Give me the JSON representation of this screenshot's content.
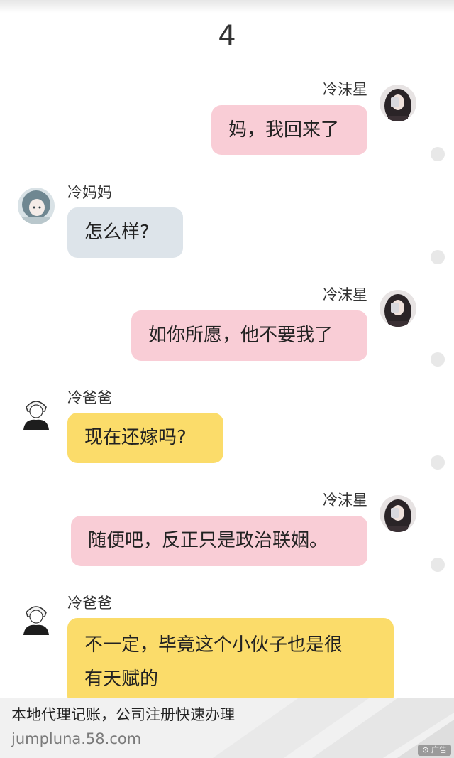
{
  "page": {
    "number": "4"
  },
  "messages": [
    {
      "side": "right",
      "sender": "冷沫星",
      "text": "妈，我回来了",
      "color": "#f9cdd6"
    },
    {
      "side": "left",
      "sender": "冷妈妈",
      "text": "怎么样?",
      "color": "#dde4ea"
    },
    {
      "side": "right",
      "sender": "冷沫星",
      "text": "如你所愿，他不要我了",
      "color": "#f9cdd6"
    },
    {
      "side": "left",
      "sender": "冷爸爸",
      "text": "现在还嫁吗?",
      "color": "#fbdc6a"
    },
    {
      "side": "right",
      "sender": "冷沫星",
      "text": "随便吧，反正只是政治联姻。",
      "color": "#f9cdd6"
    },
    {
      "side": "left",
      "sender": "冷爸爸",
      "lines": [
        "不一定，毕竟这个小伙子也是很",
        "有天赋的"
      ],
      "color": "#fbdc6a"
    }
  ],
  "ad": {
    "title": "本地代理记账，公司注册快速办理",
    "url": "jumpluna.58.com",
    "badge": "广告"
  }
}
